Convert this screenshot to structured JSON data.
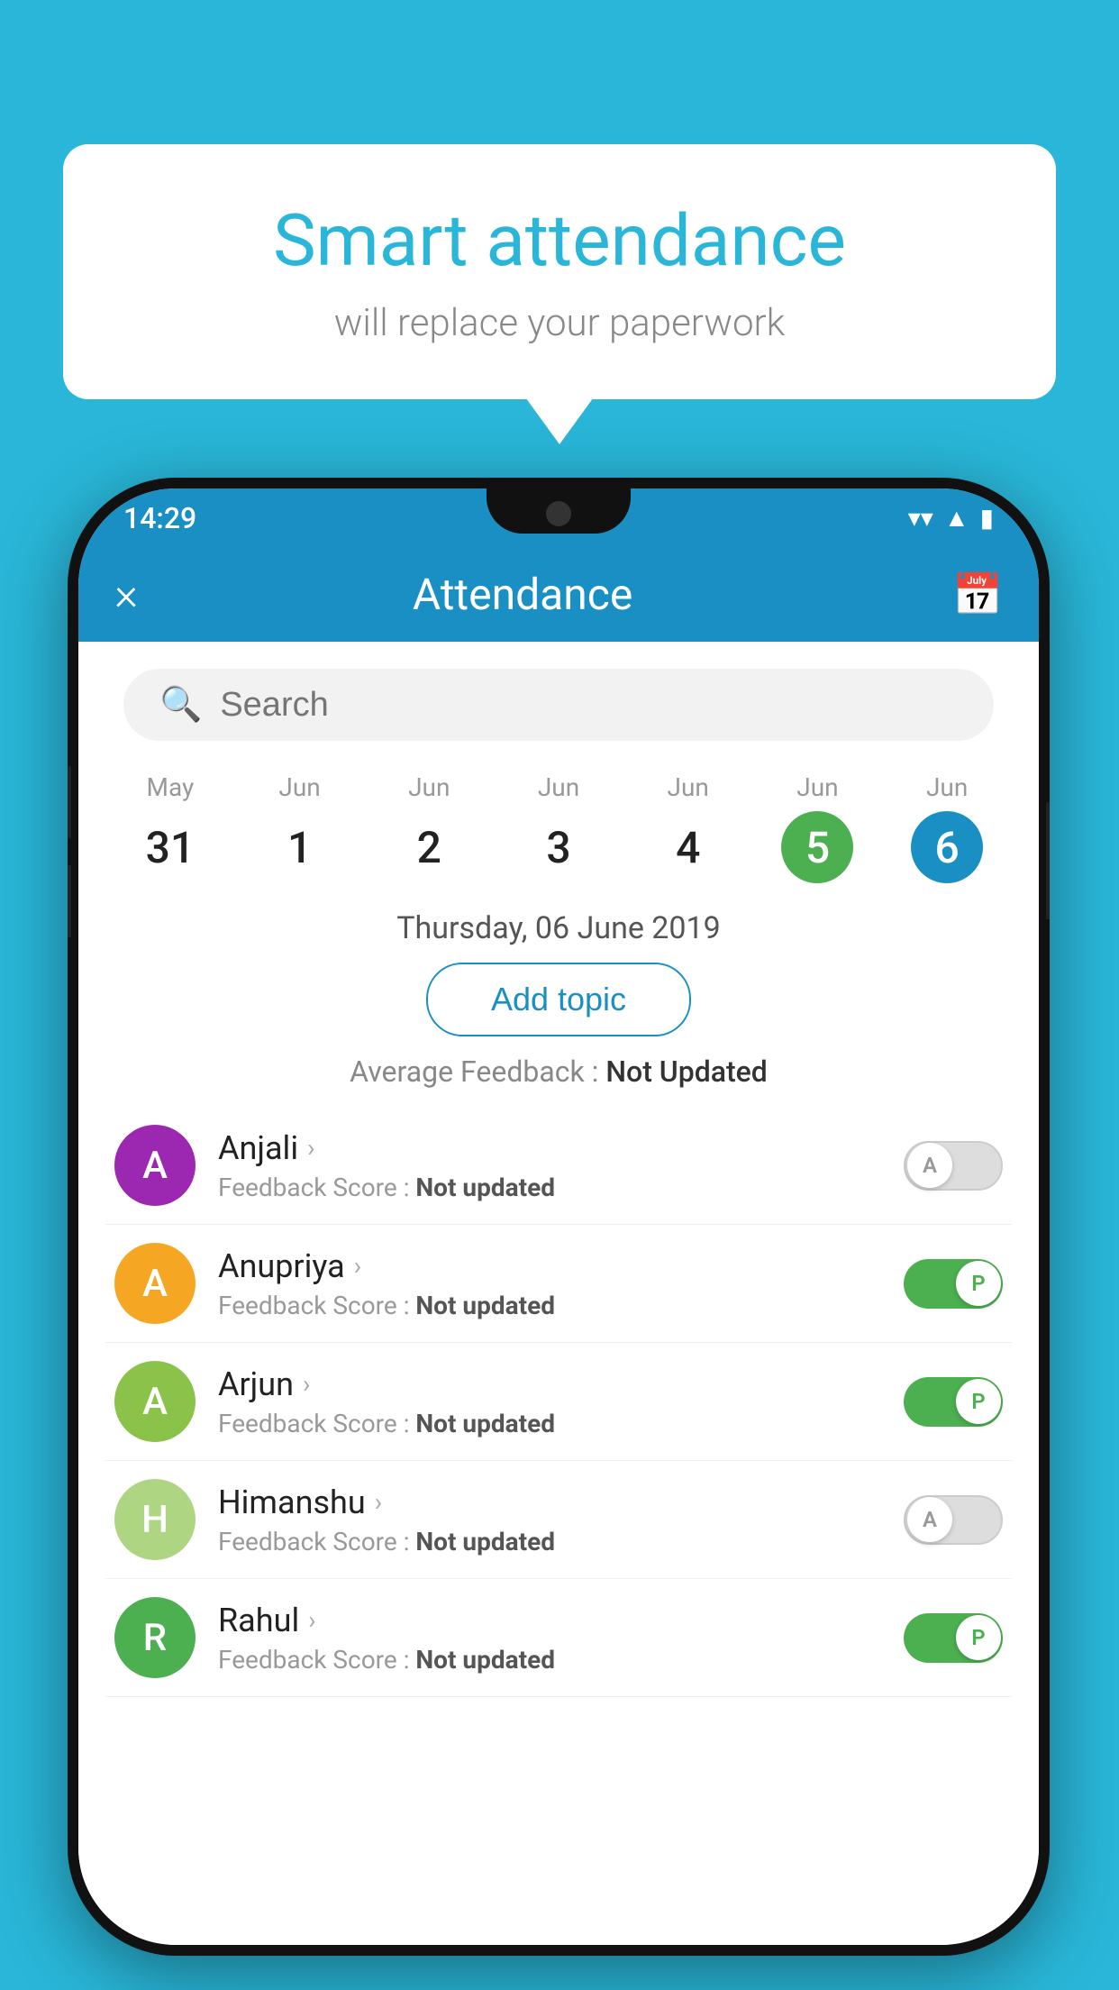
{
  "background_color": "#29b6d8",
  "bubble": {
    "title": "Smart attendance",
    "subtitle": "will replace your paperwork"
  },
  "status_bar": {
    "time": "14:29",
    "wifi": "▼",
    "signal": "▲",
    "battery": "▮"
  },
  "header": {
    "title": "Attendance",
    "close_label": "×",
    "calendar_icon": "📅"
  },
  "search": {
    "placeholder": "Search"
  },
  "calendar": {
    "days": [
      {
        "month": "May",
        "num": "31",
        "state": "normal"
      },
      {
        "month": "Jun",
        "num": "1",
        "state": "normal"
      },
      {
        "month": "Jun",
        "num": "2",
        "state": "normal"
      },
      {
        "month": "Jun",
        "num": "3",
        "state": "normal"
      },
      {
        "month": "Jun",
        "num": "4",
        "state": "normal"
      },
      {
        "month": "Jun",
        "num": "5",
        "state": "today"
      },
      {
        "month": "Jun",
        "num": "6",
        "state": "selected"
      }
    ]
  },
  "selected_date": "Thursday, 06 June 2019",
  "add_topic_label": "Add topic",
  "avg_feedback_label": "Average Feedback : ",
  "avg_feedback_value": "Not Updated",
  "students": [
    {
      "name": "Anjali",
      "avatar_letter": "A",
      "avatar_color": "#9c27b0",
      "feedback_label": "Feedback Score : ",
      "feedback_value": "Not updated",
      "toggle_state": "off",
      "toggle_letter": "A"
    },
    {
      "name": "Anupriya",
      "avatar_letter": "A",
      "avatar_color": "#f5a623",
      "feedback_label": "Feedback Score : ",
      "feedback_value": "Not updated",
      "toggle_state": "on",
      "toggle_letter": "P"
    },
    {
      "name": "Arjun",
      "avatar_letter": "A",
      "avatar_color": "#8bc34a",
      "feedback_label": "Feedback Score : ",
      "feedback_value": "Not updated",
      "toggle_state": "on",
      "toggle_letter": "P"
    },
    {
      "name": "Himanshu",
      "avatar_letter": "H",
      "avatar_color": "#aed581",
      "feedback_label": "Feedback Score : ",
      "feedback_value": "Not updated",
      "toggle_state": "off",
      "toggle_letter": "A"
    },
    {
      "name": "Rahul",
      "avatar_letter": "R",
      "avatar_color": "#4caf50",
      "feedback_label": "Feedback Score : ",
      "feedback_value": "Not updated",
      "toggle_state": "on",
      "toggle_letter": "P"
    }
  ]
}
